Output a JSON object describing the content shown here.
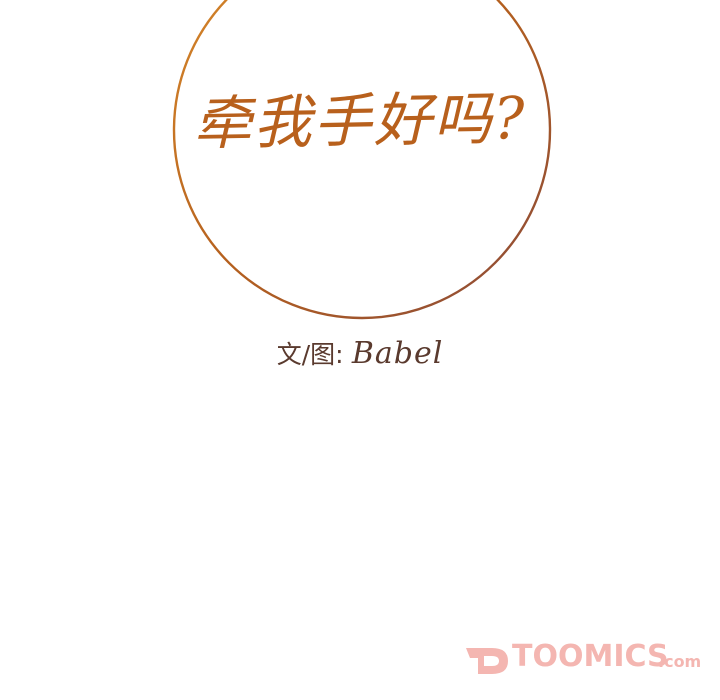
{
  "panel": {
    "title": "牵我手好吗?",
    "credit_prefix": "文/图:",
    "credit_author": "Babel"
  },
  "watermark": {
    "logo_name": "TOOMICS",
    "logo_suffix": ".com"
  },
  "colors": {
    "circle_stroke": "#c2701f",
    "title": "#b8601c",
    "credit": "#5a3a2e",
    "watermark": "#f4b6b1"
  }
}
